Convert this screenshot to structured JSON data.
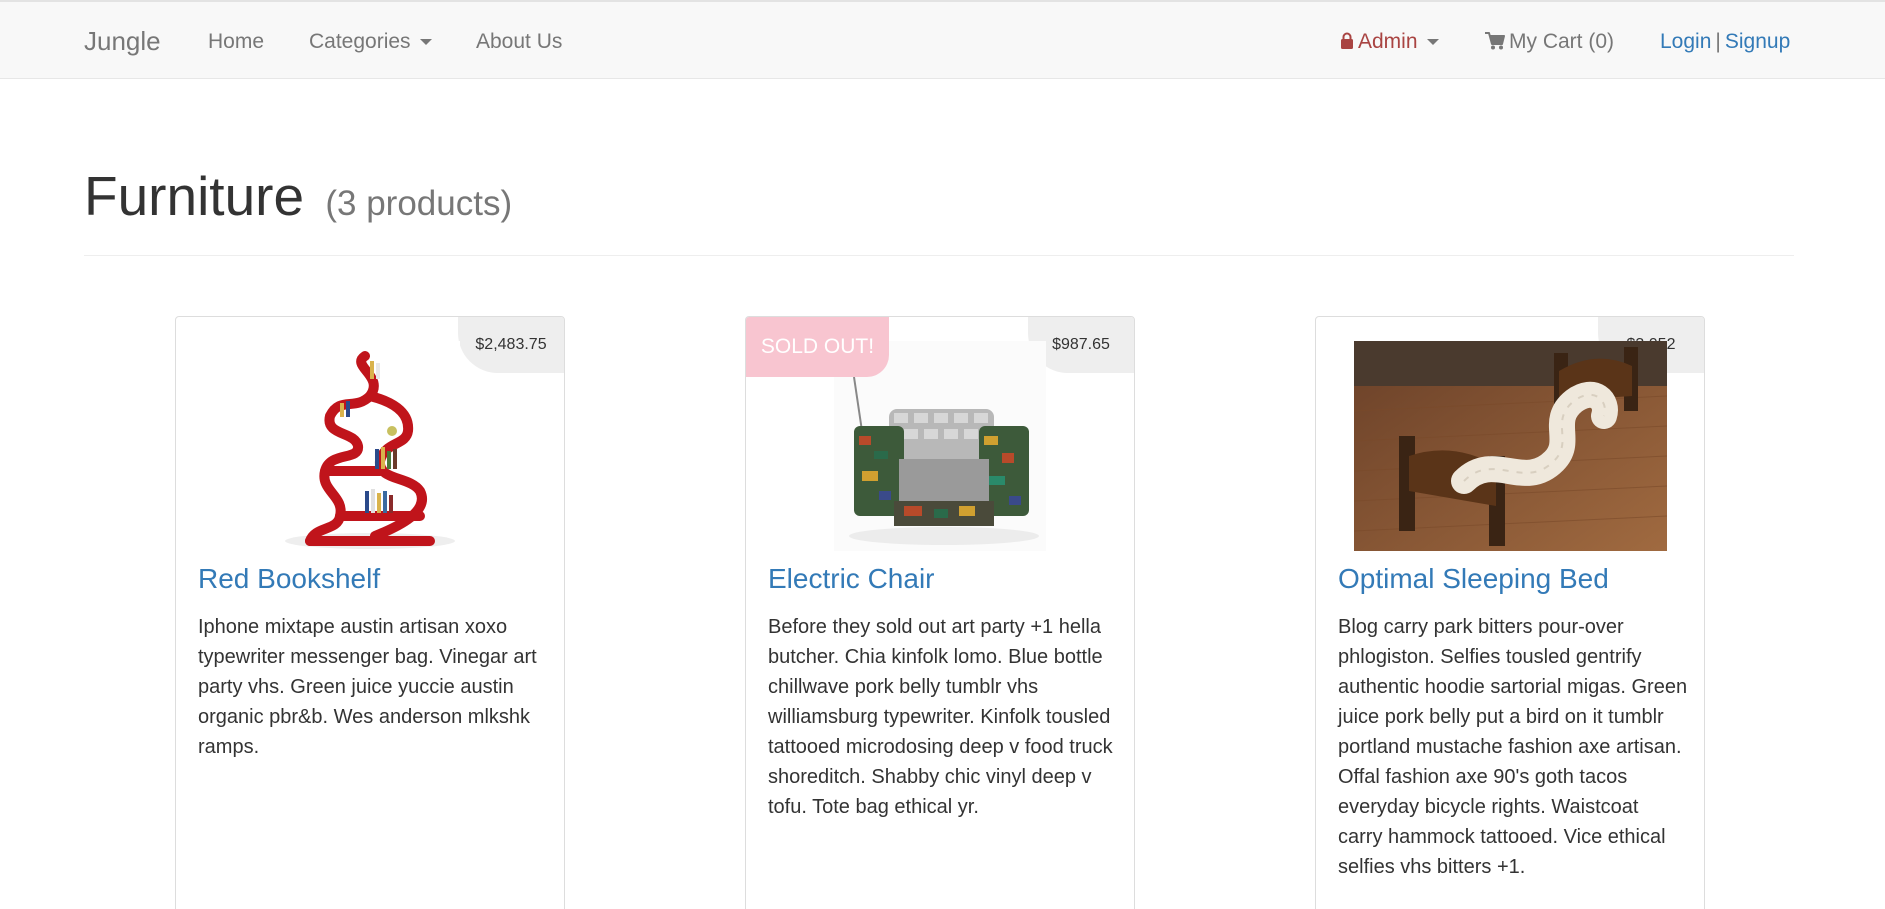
{
  "nav": {
    "brand": "Jungle",
    "home": "Home",
    "categories": "Categories",
    "about": "About Us",
    "admin": "Admin",
    "cart": "My Cart (0)",
    "login": "Login",
    "separator": "|",
    "signup": "Signup"
  },
  "page": {
    "title": "Furniture",
    "count": "(3 products)"
  },
  "products": [
    {
      "name": "Red Bookshelf",
      "price": "$2,483.75",
      "description": "Iphone mixtape austin artisan xoxo typewriter messenger bag. Vinegar art party vhs. Green juice yuccie austin organic pbr&b. Wes anderson mlkshk ramps."
    },
    {
      "name": "Electric Chair",
      "price": "$987.65",
      "badge": "SOLD OUT!",
      "description": "Before they sold out art party +1 hella butcher. Chia kinfolk lomo. Blue bottle chillwave pork belly tumblr vhs williamsburg typewriter. Kinfolk tousled tattooed microdosing deep v food truck shoreditch. Shabby chic vinyl deep v tofu. Tote bag ethical yr."
    },
    {
      "name": "Optimal Sleeping Bed",
      "price": "$3,052",
      "description": "Blog carry park bitters pour-over phlogiston. Selfies tousled gentrify authentic hoodie sartorial migas. Green juice pork belly put a bird on it tumblr portland mustache fashion axe artisan. Offal fashion axe 90's goth tacos everyday bicycle rights. Waistcoat carry hammock tattooed. Vice ethical selfies vhs bitters +1."
    }
  ],
  "colors": {
    "link": "#337ab7",
    "admin": "#a94442",
    "sold_out_badge": "#f8c5d0",
    "navbar_bg": "#f8f8f8"
  },
  "icons": {
    "admin": "lock-icon",
    "cart": "shopping-cart-icon",
    "dropdown": "caret-down-icon"
  }
}
